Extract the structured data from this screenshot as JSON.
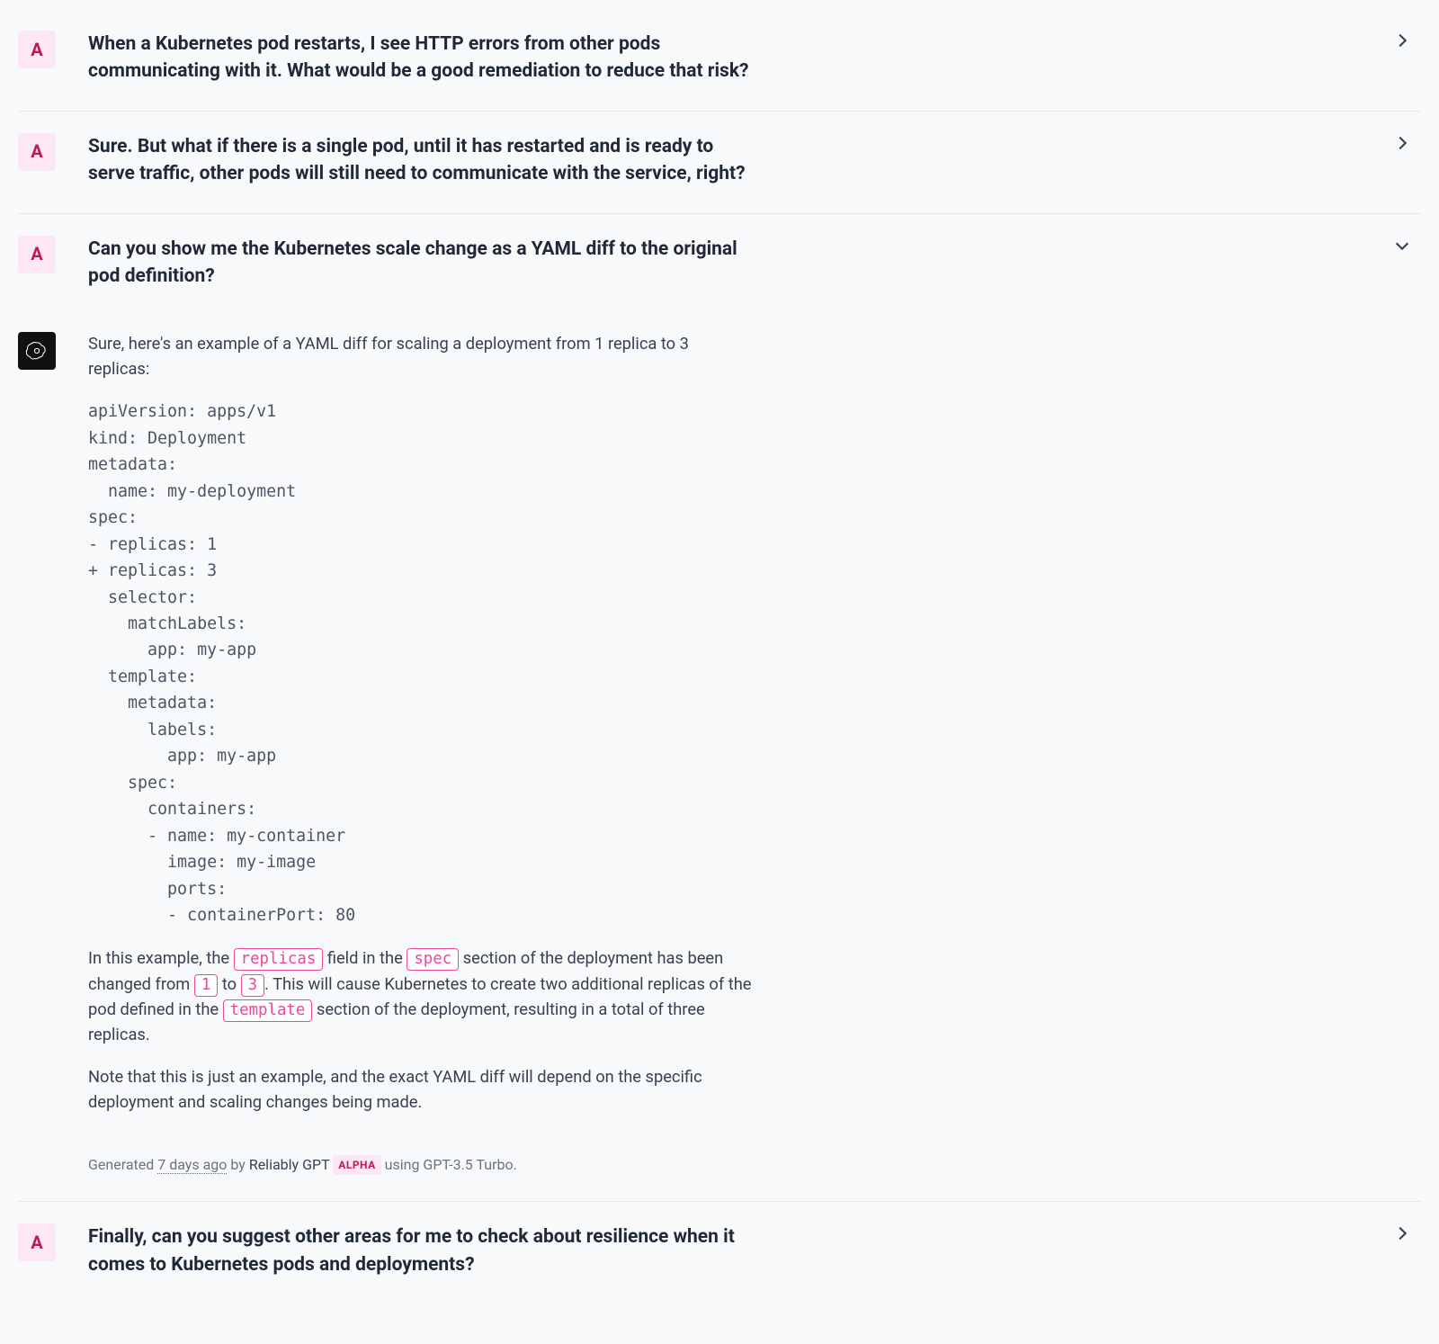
{
  "user_initial": "A",
  "thread": [
    {
      "role": "user",
      "summary": "When a Kubernetes pod restarts, I see HTTP errors from other pods communicating with it. What would be a good remediation to reduce that risk?",
      "collapsed": true
    },
    {
      "role": "user",
      "summary": "Sure. But what if there is a single pod, until it has restarted and is ready to serve traffic, other pods will still need to communicate with the service, right?",
      "collapsed": true
    },
    {
      "role": "user",
      "summary": "Can you show me the Kubernetes scale change as a YAML diff to the original pod definition?",
      "collapsed": false
    }
  ],
  "answer": {
    "intro": "Sure, here's an example of a YAML diff for scaling a deployment from 1 replica to 3 replicas:",
    "code": "apiVersion: apps/v1\nkind: Deployment\nmetadata:\n  name: my-deployment\nspec:\n- replicas: 1\n+ replicas: 3\n  selector:\n    matchLabels:\n      app: my-app\n  template:\n    metadata:\n      labels:\n        app: my-app\n    spec:\n      containers:\n      - name: my-container\n        image: my-image\n        ports:\n        - containerPort: 80",
    "explain_parts": {
      "p1a": "In this example, the ",
      "c1": "replicas",
      "p1b": " field in the ",
      "c2": "spec",
      "p1c": " section of the deployment has been changed from ",
      "c3": "1",
      "p1d": " to ",
      "c4": "3",
      "p1e": ". This will cause Kubernetes to create two additional replicas of the pod defined in the ",
      "c5": "template",
      "p1f": " section of the deployment, resulting in a total of three replicas."
    },
    "note": "Note that this is just an example, and the exact YAML diff will depend on the specific deployment and scaling changes being made."
  },
  "meta": {
    "generated_label": "Generated ",
    "time_ago": "7 days ago",
    "by": " by ",
    "generator": "Reliably GPT",
    "badge": "ALPHA",
    "using": " using GPT-3.5 Turbo."
  },
  "final": {
    "summary": "Finally, can you suggest other areas for me to check about resilience when it comes to Kubernetes pods and deployments?"
  }
}
